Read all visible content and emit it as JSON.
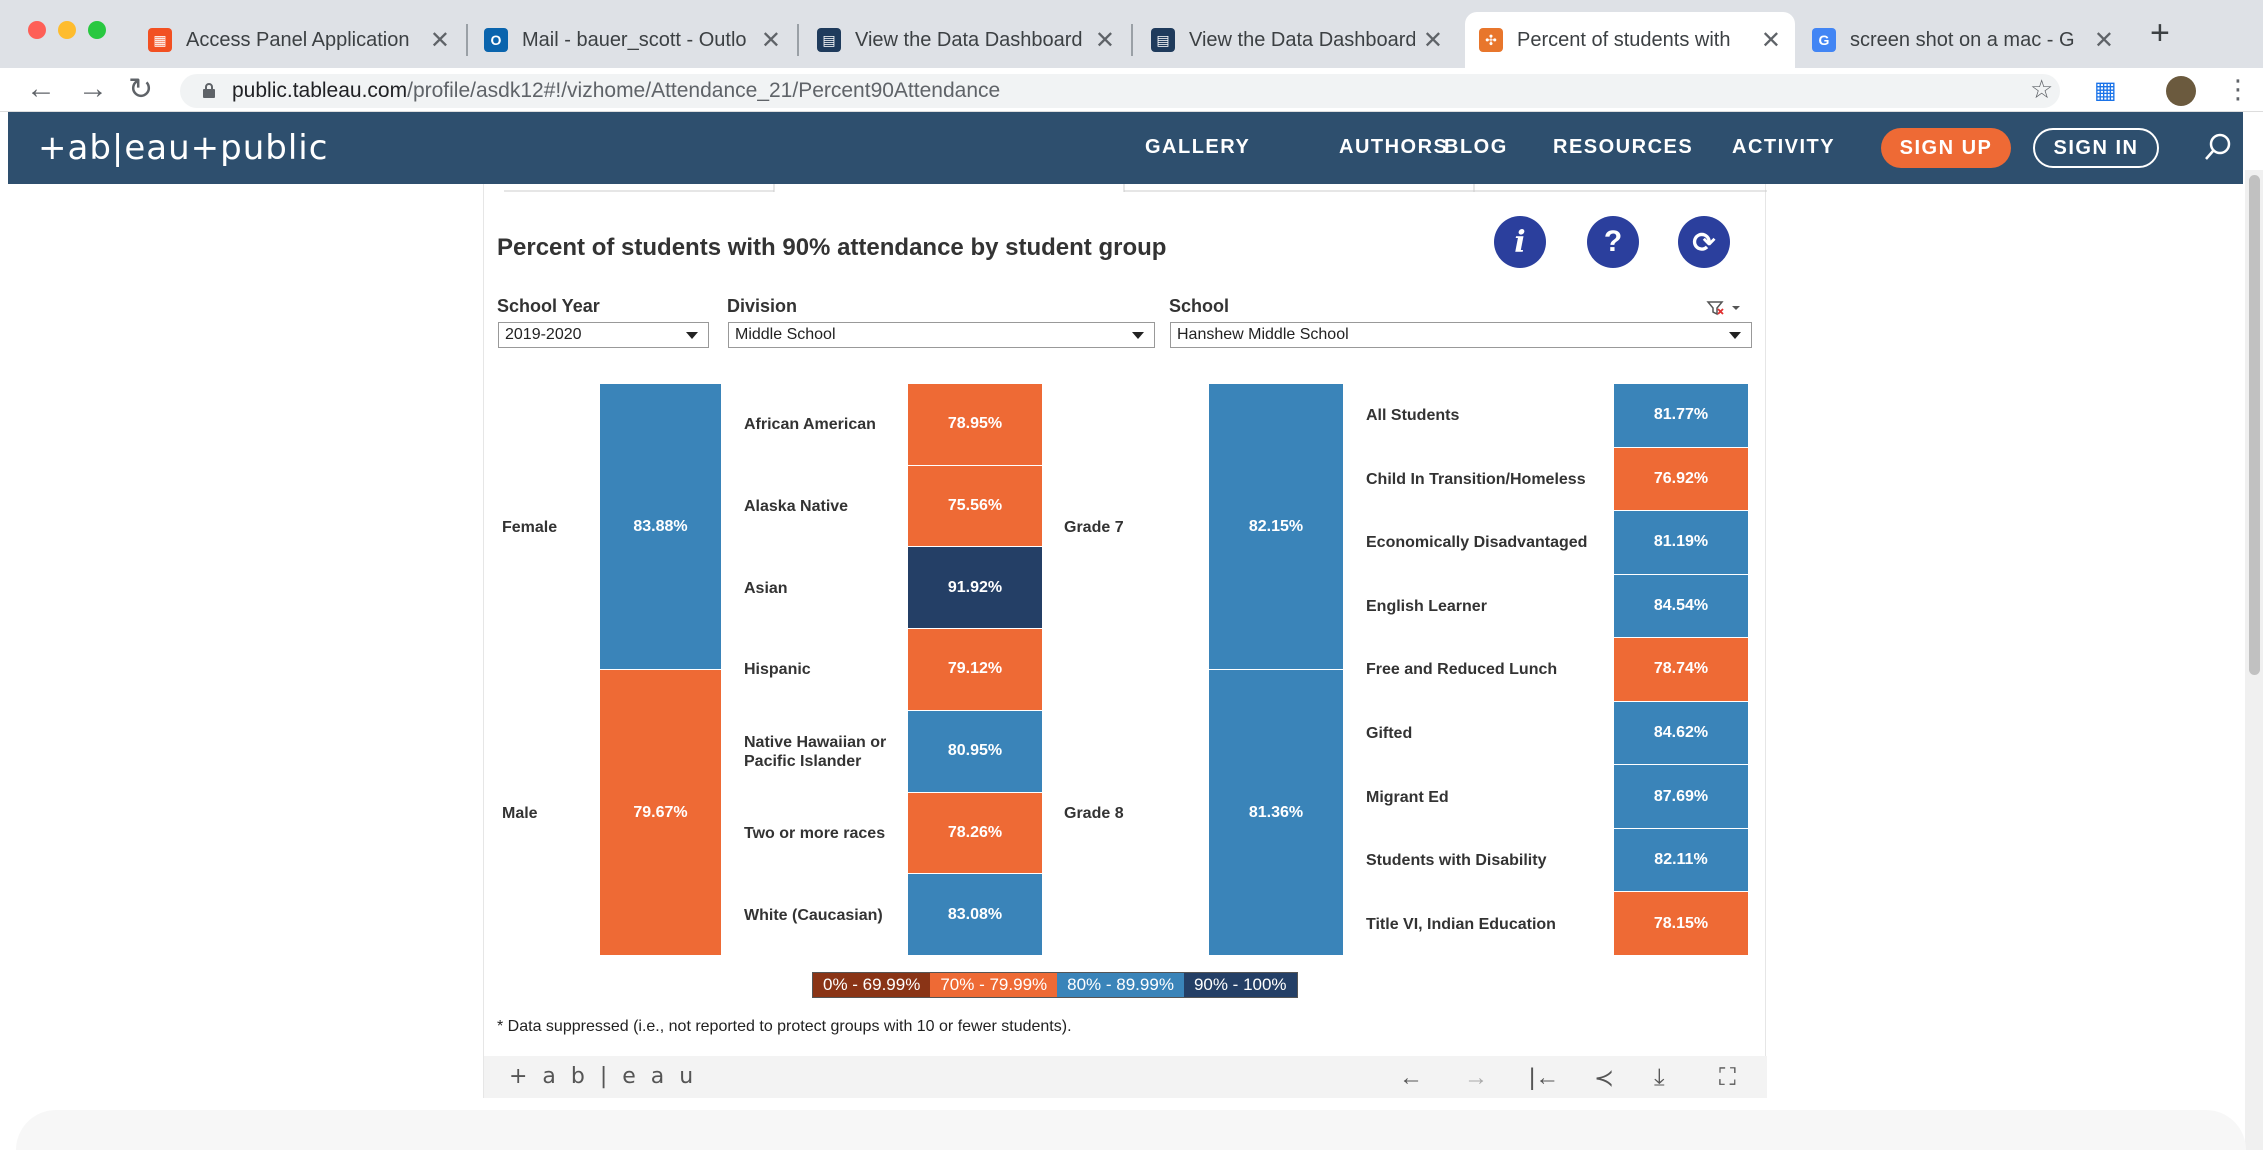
{
  "browser": {
    "tabs": [
      {
        "title": "Access Panel Application",
        "icon": "microsoft-icon"
      },
      {
        "title": "Mail - bauer_scott - Outlo",
        "icon": "outlook-icon"
      },
      {
        "title": "View the Data Dashboard",
        "icon": "dashboard-icon"
      },
      {
        "title": "View the Data Dashboard",
        "icon": "dashboard-icon"
      },
      {
        "title": "Percent of students with",
        "icon": "tableau-icon"
      },
      {
        "title": "screen shot on a mac - G",
        "icon": "google-icon"
      }
    ],
    "active_tab": 4,
    "url_host": "public.tableau.com",
    "url_path": "/profile/asdk12#!/vizhome/Attendance_21/Percent90Attendance"
  },
  "header": {
    "logo": "+ab|eau+public",
    "nav": [
      "GALLERY",
      "AUTHORS",
      "BLOG",
      "RESOURCES",
      "ACTIVITY"
    ],
    "signup": "SIGN UP",
    "signin": "SIGN IN"
  },
  "viz": {
    "title": "Percent of students with 90% attendance by student group",
    "filters": {
      "school_year": {
        "label": "School Year",
        "value": "2019-2020"
      },
      "division": {
        "label": "Division",
        "value": "Middle School"
      },
      "school": {
        "label": "School",
        "value": "Hanshew Middle School"
      }
    },
    "legend": [
      {
        "label": "0% - 69.99%",
        "color": "#8a3416"
      },
      {
        "label": "70% - 79.99%",
        "color": "#ee6a35"
      },
      {
        "label": "80% - 89.99%",
        "color": "#3a84b9"
      },
      {
        "label": "90% - 100%",
        "color": "#243f66"
      }
    ],
    "footnote": "* Data suppressed (i.e., not reported to protect groups with 10 or fewer students).",
    "toolbar_logo": "+ a b | e a u"
  },
  "chart_data": [
    {
      "type": "bar",
      "title": "",
      "categories": [
        "Female",
        "Male"
      ],
      "values": [
        "83.88%",
        "79.67%"
      ],
      "colors": [
        "#3a84b9",
        "#ee6a35"
      ]
    },
    {
      "type": "bar",
      "title": "",
      "categories": [
        "African American",
        "Alaska Native",
        "Asian",
        "Hispanic",
        "Native Hawaiian or Pacific Islander",
        "Two or more races",
        "White (Caucasian)"
      ],
      "values": [
        "78.95%",
        "75.56%",
        "91.92%",
        "79.12%",
        "80.95%",
        "78.26%",
        "83.08%"
      ],
      "colors": [
        "#ee6a35",
        "#ee6a35",
        "#243f66",
        "#ee6a35",
        "#3a84b9",
        "#ee6a35",
        "#3a84b9"
      ]
    },
    {
      "type": "bar",
      "title": "",
      "categories": [
        "Grade 7",
        "Grade 8"
      ],
      "values": [
        "82.15%",
        "81.36%"
      ],
      "colors": [
        "#3a84b9",
        "#3a84b9"
      ]
    },
    {
      "type": "bar",
      "title": "",
      "categories": [
        "All Students",
        "Child In Transition/Homeless",
        "Economically Disadvantaged",
        "English Learner",
        "Free and Reduced Lunch",
        "Gifted",
        "Migrant Ed",
        "Students with Disability",
        "Title VI, Indian Education"
      ],
      "values": [
        "81.77%",
        "76.92%",
        "81.19%",
        "84.54%",
        "78.74%",
        "84.62%",
        "87.69%",
        "82.11%",
        "78.15%"
      ],
      "colors": [
        "#3a84b9",
        "#ee6a35",
        "#3a84b9",
        "#3a84b9",
        "#ee6a35",
        "#3a84b9",
        "#3a84b9",
        "#3a84b9",
        "#ee6a35"
      ]
    }
  ]
}
